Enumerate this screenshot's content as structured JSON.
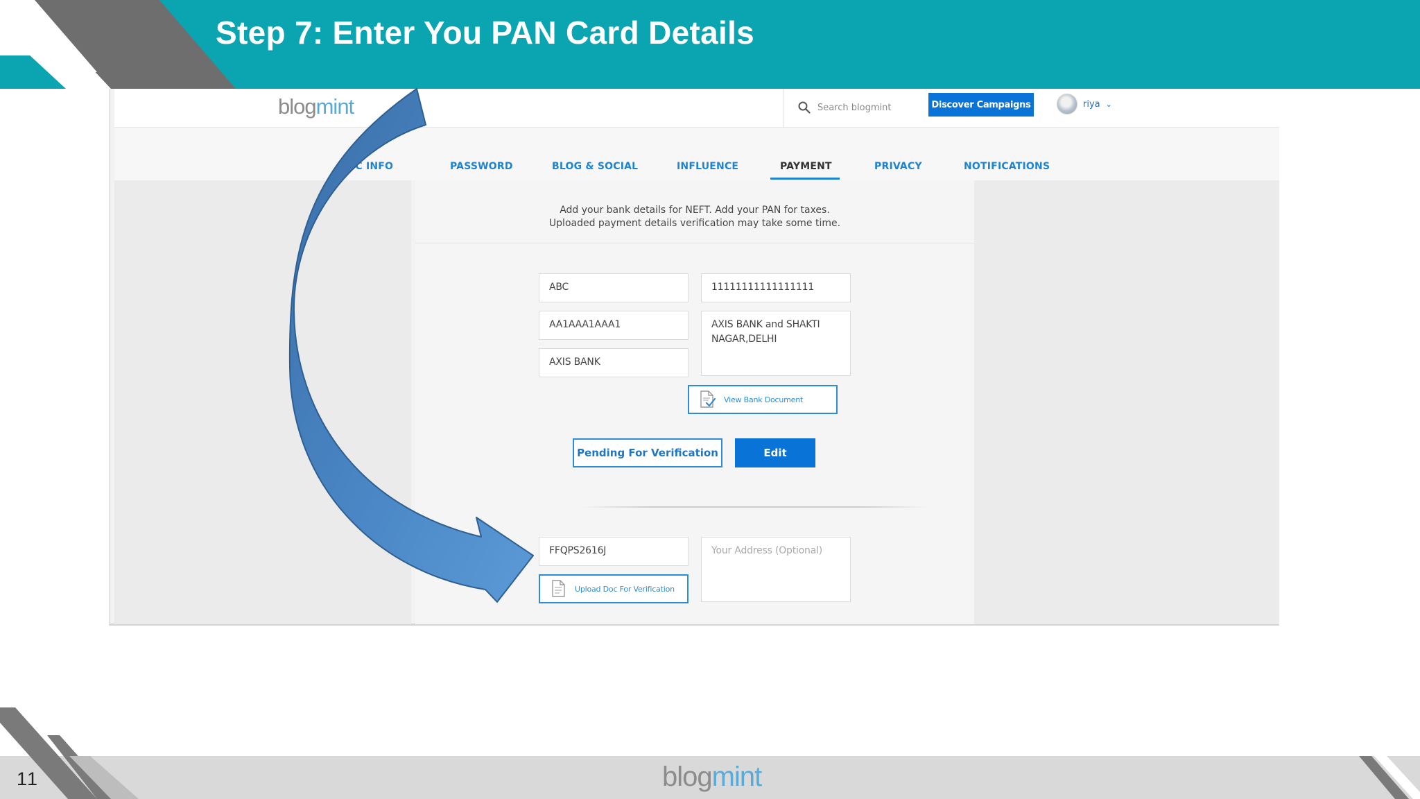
{
  "slide": {
    "title": "Step 7: Enter You PAN Card Details",
    "page_number": "11",
    "footer_logo": {
      "part1": "blog",
      "part2": "mint"
    }
  },
  "colors": {
    "header_teal": "#0aa5b1",
    "primary_blue": "#0a73d8",
    "link_blue": "#1f84cf",
    "arrow_blue": "#3d79bd",
    "footer_gray": "#d9d9d9"
  },
  "app": {
    "logo": {
      "part1": "blog",
      "part2": "mint"
    },
    "search_placeholder": "Search blogmint",
    "search_icon": "search-icon",
    "discover_label": "Discover Campaigns",
    "user_name": "riya",
    "user_chevron": "⌄"
  },
  "tabs": [
    {
      "label": "BASIC INFO",
      "visible_label": "IC INFO",
      "active": false
    },
    {
      "label": "PASSWORD",
      "active": false
    },
    {
      "label": "BLOG & SOCIAL",
      "active": false
    },
    {
      "label": "INFLUENCE",
      "active": false
    },
    {
      "label": "PAYMENT",
      "active": true
    },
    {
      "label": "PRIVACY",
      "active": false
    },
    {
      "label": "NOTIFICATIONS",
      "active": false
    }
  ],
  "payment": {
    "intro_line1": "Add your bank details for NEFT. Add your PAN for taxes.",
    "intro_line2": "Uploaded payment details verification may take some time.",
    "account_name": "ABC",
    "account_number": "11111111111111111",
    "ifsc": "AA1AAA1AAA1",
    "bank_address": "AXIS BANK and SHAKTI NAGAR,DELHI",
    "bank_name": "AXIS BANK",
    "view_doc_label": "View Bank Document",
    "pending_label": "Pending For Verification",
    "edit_label": "Edit",
    "pan_number": "FFQPS2616J",
    "address_placeholder": "Your Address (Optional)",
    "upload_label": "Upload Doc For Verification"
  }
}
